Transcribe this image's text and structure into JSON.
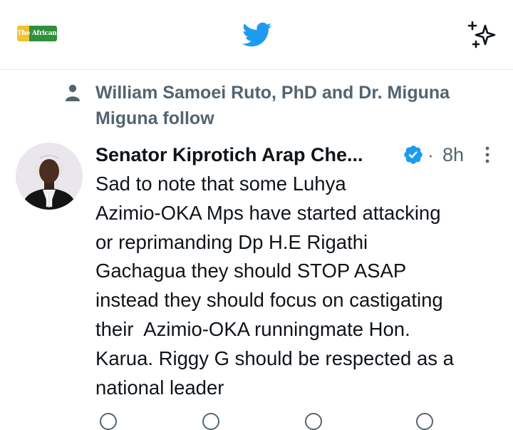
{
  "header": {
    "logo_text": "The African Voice",
    "icons": [
      "twitter-bird-icon",
      "sparkle-icon"
    ],
    "brand_color": "#1d9bf0"
  },
  "social_context": {
    "icon": "person-icon",
    "text_line1": "William Samoei Ruto, PhD and Dr. Miguna",
    "text_line2": "Miguna follow"
  },
  "tweet": {
    "author_name": "Senator Kiprotich Arap Che...",
    "verified": true,
    "separator": "·",
    "timestamp": "8h",
    "body_lines": [
      "Sad to note that some Luhya",
      "Azimio-OKA Mps have started attacking",
      "or reprimanding Dp H.E Rigathi",
      "Gachagua they should STOP ASAP",
      "instead they should focus on castigating",
      "their  Azimio-OKA runningmate Hon.",
      "Karua. Riggy G should be respected as a",
      "national leader"
    ]
  },
  "colors": {
    "text_primary": "#0f1419",
    "text_secondary": "#536471",
    "verified": "#1d9bf0",
    "divider": "#e7ecf0"
  }
}
